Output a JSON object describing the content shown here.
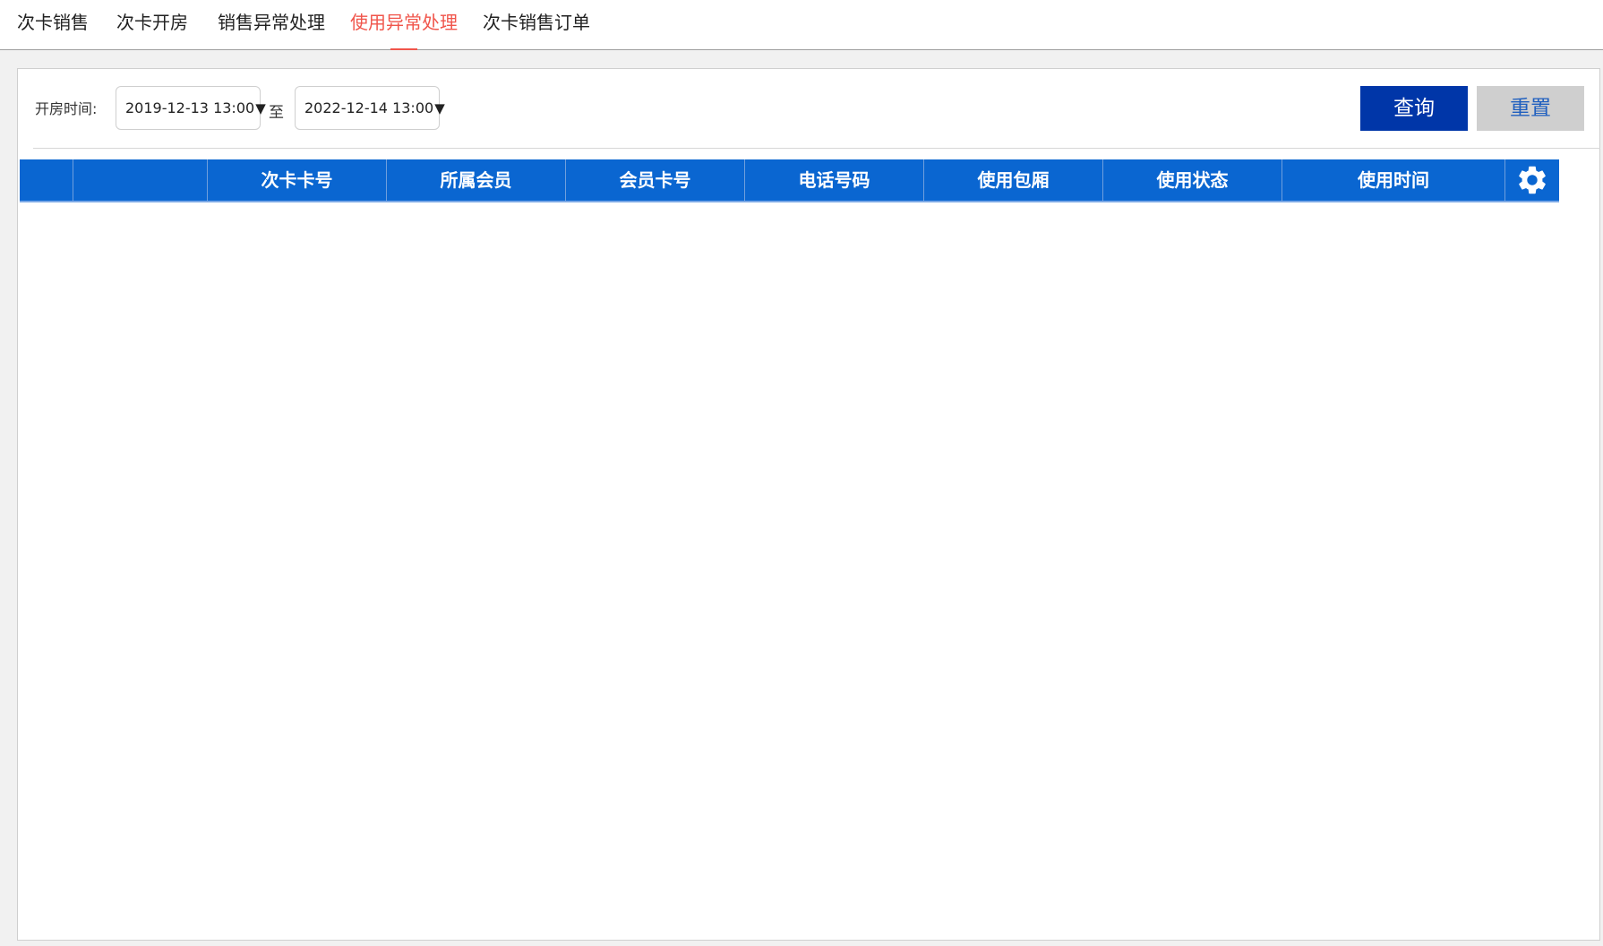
{
  "tabs": [
    {
      "label": "次卡销售",
      "active": false
    },
    {
      "label": "次卡开房",
      "active": false
    },
    {
      "label": "销售异常处理",
      "active": false
    },
    {
      "label": "使用异常处理",
      "active": true
    },
    {
      "label": "次卡销售订单",
      "active": false
    }
  ],
  "filter": {
    "label": "开房时间:",
    "start_date": "2019-12-13 13:00",
    "separator": "至",
    "end_date": "2022-12-14 13:00",
    "dropdown_arrow": "▼"
  },
  "buttons": {
    "query": "查询",
    "reset": "重置"
  },
  "table": {
    "columns": [
      "",
      "",
      "次卡卡号",
      "所属会员",
      "会员卡号",
      "电话号码",
      "使用包厢",
      "使用状态",
      "使用时间"
    ],
    "settings_icon": "gear-icon",
    "rows": []
  },
  "colors": {
    "active_tab": "#f0554b",
    "header_bg": "#0a66d1",
    "query_bg": "#0036a8",
    "reset_bg": "#cfcfcf"
  }
}
